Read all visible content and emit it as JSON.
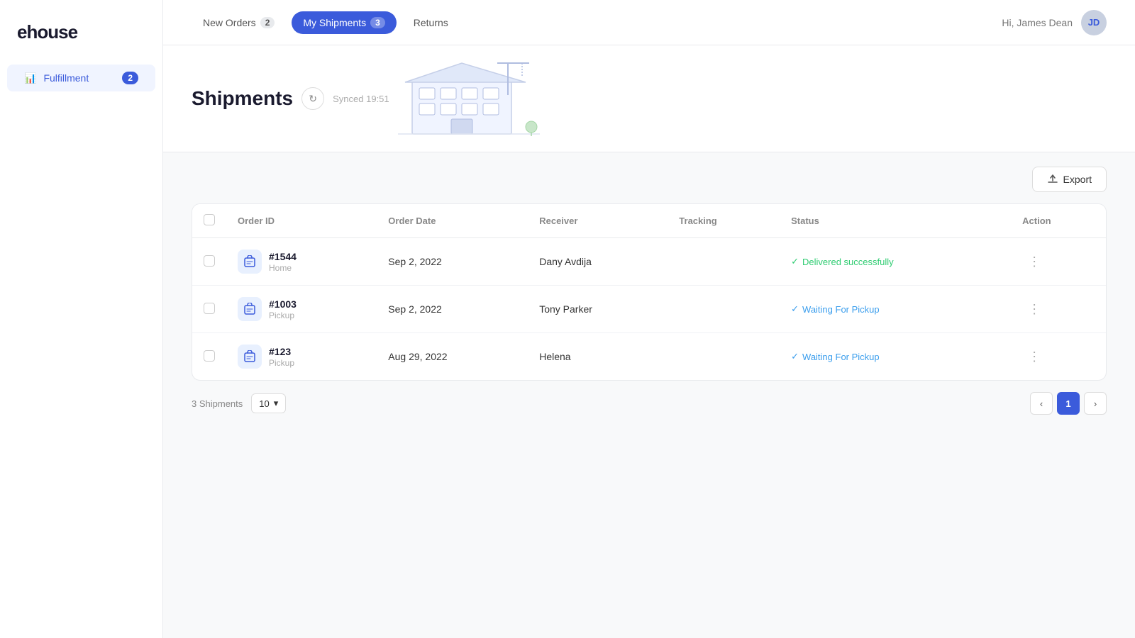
{
  "app": {
    "logo": "ehouse"
  },
  "sidebar": {
    "items": [
      {
        "id": "fulfillment",
        "label": "Fulfillment",
        "icon": "📊",
        "badge": "2",
        "active": true
      }
    ]
  },
  "topnav": {
    "tabs": [
      {
        "id": "new-orders",
        "label": "New Orders",
        "badge": "2",
        "active": false
      },
      {
        "id": "my-shipments",
        "label": "My Shipments",
        "badge": "3",
        "active": true
      },
      {
        "id": "returns",
        "label": "Returns",
        "badge": "",
        "active": false
      }
    ],
    "greeting": "Hi, James Dean",
    "avatar_initials": "JD"
  },
  "page": {
    "title": "Shipments",
    "sync_label": "↻",
    "synced_text": "Synced 19:51"
  },
  "toolbar": {
    "export_label": "Export"
  },
  "table": {
    "columns": [
      "",
      "Order ID",
      "Order Date",
      "Receiver",
      "Tracking",
      "Status",
      "Action"
    ],
    "rows": [
      {
        "id": "#1544",
        "type": "Home",
        "date": "Sep 2, 2022",
        "receiver": "Dany Avdija",
        "tracking": "",
        "status": "Delivered successfully",
        "status_type": "delivered"
      },
      {
        "id": "#1003",
        "type": "Pickup",
        "date": "Sep 2, 2022",
        "receiver": "Tony Parker",
        "tracking": "",
        "status": "Waiting For Pickup",
        "status_type": "waiting"
      },
      {
        "id": "#123",
        "type": "Pickup",
        "date": "Aug 29, 2022",
        "receiver": "Helena",
        "tracking": "",
        "status": "Waiting For Pickup",
        "status_type": "waiting"
      }
    ]
  },
  "pagination": {
    "total_label": "3 Shipments",
    "per_page": "10",
    "current_page": "1",
    "prev_icon": "‹",
    "next_icon": "›"
  }
}
